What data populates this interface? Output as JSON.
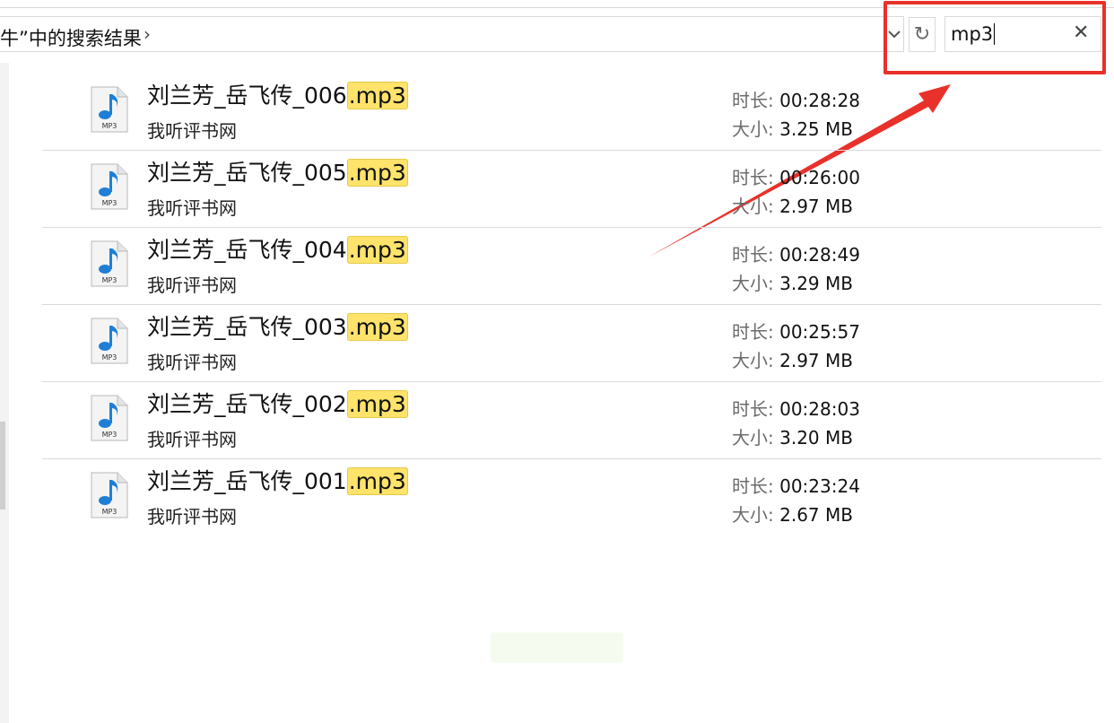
{
  "address": {
    "breadcrumb": "牛”中的搜索结果"
  },
  "search": {
    "value": "mp3"
  },
  "colors": {
    "highlight_frame": "#e8312a",
    "match_highlight": "#ffe36b"
  },
  "results": [
    {
      "name_prefix": "刘兰芳_岳飞传_006",
      "name_match": ".mp3",
      "subtitle": "我听评书网",
      "duration_label": "时长:",
      "duration": "00:28:28",
      "size_label": "大小:",
      "size": "3.25 MB"
    },
    {
      "name_prefix": "刘兰芳_岳飞传_005",
      "name_match": ".mp3",
      "subtitle": "我听评书网",
      "duration_label": "时长:",
      "duration": "00:26:00",
      "size_label": "大小:",
      "size": "2.97 MB"
    },
    {
      "name_prefix": "刘兰芳_岳飞传_004",
      "name_match": ".mp3",
      "subtitle": "我听评书网",
      "duration_label": "时长:",
      "duration": "00:28:49",
      "size_label": "大小:",
      "size": "3.29 MB"
    },
    {
      "name_prefix": "刘兰芳_岳飞传_003",
      "name_match": ".mp3",
      "subtitle": "我听评书网",
      "duration_label": "时长:",
      "duration": "00:25:57",
      "size_label": "大小:",
      "size": "2.97 MB"
    },
    {
      "name_prefix": "刘兰芳_岳飞传_002",
      "name_match": ".mp3",
      "subtitle": "我听评书网",
      "duration_label": "时长:",
      "duration": "00:28:03",
      "size_label": "大小:",
      "size": "3.20 MB"
    },
    {
      "name_prefix": "刘兰芳_岳飞传_001",
      "name_match": ".mp3",
      "subtitle": "我听评书网",
      "duration_label": "时长:",
      "duration": "00:23:24",
      "size_label": "大小:",
      "size": "2.67 MB"
    }
  ],
  "icons": {
    "file": "mp3-file-icon",
    "file_badge": "MP3",
    "dropdown": "chevron-down-icon",
    "refresh": "refresh-icon",
    "clear": "close-icon",
    "breadcrumb_sep": "chevron-right-icon"
  }
}
